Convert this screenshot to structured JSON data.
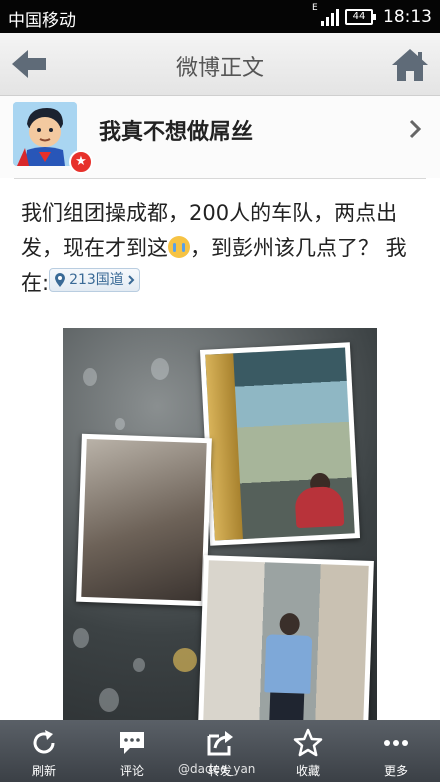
{
  "status_bar": {
    "carrier": "中国移动",
    "network_type": "E",
    "battery_level": "44",
    "time": "18:13"
  },
  "header": {
    "title": "微博正文",
    "back_icon": "back-arrow-icon",
    "home_icon": "home-icon"
  },
  "user": {
    "name": "我真不想做屌丝",
    "badge_icon": "weibo-badge-icon",
    "avatar_icon": "superman-avatar"
  },
  "post": {
    "text_part1": "我们组团操成都，200人的车队，两点出发，现在才到这",
    "text_part2": "，到彭州该几点了？ 我在:",
    "emoji_icon": "crying-emoji-icon",
    "location": "213国道"
  },
  "toolbar": {
    "items": [
      {
        "label": "刷新",
        "icon": "refresh-icon"
      },
      {
        "label": "评论",
        "icon": "comment-icon"
      },
      {
        "label": "转发",
        "icon": "forward-icon"
      },
      {
        "label": "收藏",
        "icon": "star-icon"
      },
      {
        "label": "更多",
        "icon": "more-icon"
      }
    ]
  },
  "watermark": "@dadee_yan",
  "colors": {
    "toolbar": "#4a5056",
    "accent": "#3a6a96",
    "badge": "#e7312b"
  }
}
